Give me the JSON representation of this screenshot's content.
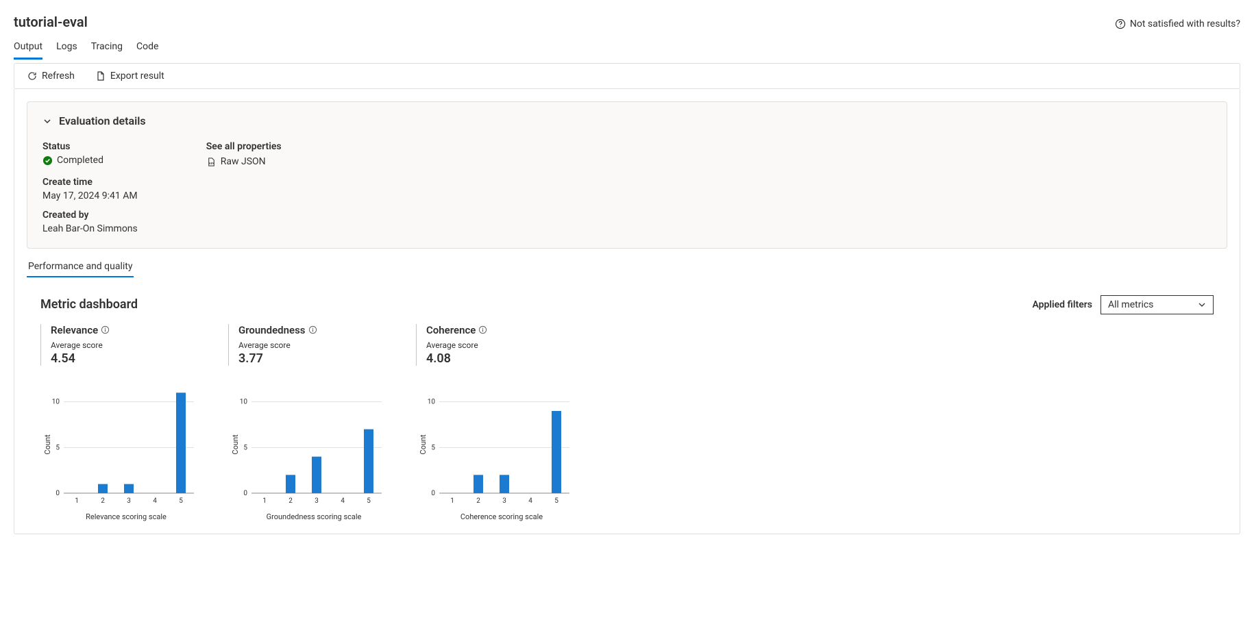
{
  "header": {
    "title": "tutorial-eval",
    "feedback_label": "Not satisfied with results?"
  },
  "tabs": [
    "Output",
    "Logs",
    "Tracing",
    "Code"
  ],
  "active_tab": "Output",
  "toolbar": {
    "refresh_label": "Refresh",
    "export_label": "Export result"
  },
  "details": {
    "header": "Evaluation details",
    "status_label": "Status",
    "status_value": "Completed",
    "create_time_label": "Create time",
    "create_time_value": "May 17, 2024 9:41 AM",
    "created_by_label": "Created by",
    "created_by_value": "Leah Bar-On Simmons",
    "see_all_label": "See all properties",
    "raw_json_label": "Raw JSON"
  },
  "subtab": "Performance and quality",
  "dashboard": {
    "title": "Metric dashboard",
    "filters_label": "Applied filters",
    "filters_value": "All metrics"
  },
  "metrics": [
    {
      "title": "Relevance",
      "sub": "Average score",
      "score": "4.54",
      "xlabel": "Relevance scoring scale"
    },
    {
      "title": "Groundedness",
      "sub": "Average score",
      "score": "3.77",
      "xlabel": "Groundedness scoring scale"
    },
    {
      "title": "Coherence",
      "sub": "Average score",
      "score": "4.08",
      "xlabel": "Coherence scoring scale"
    }
  ],
  "chart_common": {
    "ylabel": "Count",
    "yticks": [
      0,
      5,
      10
    ],
    "categories": [
      "1",
      "2",
      "3",
      "4",
      "5"
    ]
  },
  "chart_data": [
    {
      "type": "bar",
      "title": "Relevance",
      "xlabel": "Relevance scoring scale",
      "ylabel": "Count",
      "ylim": [
        0,
        12
      ],
      "categories": [
        "1",
        "2",
        "3",
        "4",
        "5"
      ],
      "values": [
        0,
        1,
        1,
        0,
        11
      ]
    },
    {
      "type": "bar",
      "title": "Groundedness",
      "xlabel": "Groundedness scoring scale",
      "ylabel": "Count",
      "ylim": [
        0,
        12
      ],
      "categories": [
        "1",
        "2",
        "3",
        "4",
        "5"
      ],
      "values": [
        0,
        2,
        4,
        0,
        7
      ]
    },
    {
      "type": "bar",
      "title": "Coherence",
      "xlabel": "Coherence scoring scale",
      "ylabel": "Count",
      "ylim": [
        0,
        12
      ],
      "categories": [
        "1",
        "2",
        "3",
        "4",
        "5"
      ],
      "values": [
        0,
        2,
        2,
        0,
        9
      ]
    }
  ]
}
